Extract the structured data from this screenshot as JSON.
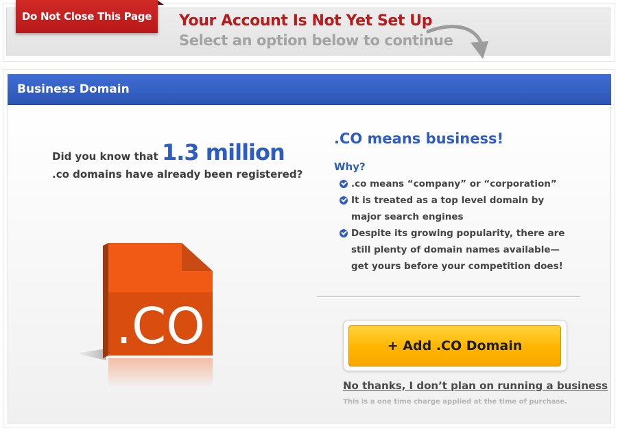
{
  "banner": {
    "ribbon_label": "Do Not Close This Page",
    "headline": "Your Account Is Not Yet Set Up",
    "subline": "Select an option below to continue"
  },
  "panel": {
    "header_title": "Business Domain",
    "left": {
      "prefix": "Did you know that ",
      "stat": "1.3 million",
      "line2": ".co domains have already been registered?",
      "logo_text": ".CO",
      "logo_color": "#f05a14"
    },
    "right": {
      "title": ".CO means business!",
      "why_label": "Why?",
      "benefits": [
        ".co means “company” or “corporation”",
        "It is treated as a top level domain by major search engines",
        "Despite its growing popularity, there are still plenty of domain names available—get yours before your competition does!"
      ],
      "add_button_label": "+ Add .CO Domain",
      "decline_link": "No thanks, I don’t plan on running a business",
      "fine_print": "This is a one time charge applied at the time of purchase."
    }
  },
  "colors": {
    "ribbon_red": "#c4201f",
    "headline_red": "#b71c1c",
    "accent_blue": "#2f5dbf",
    "button_yellow": "#ffb400"
  }
}
